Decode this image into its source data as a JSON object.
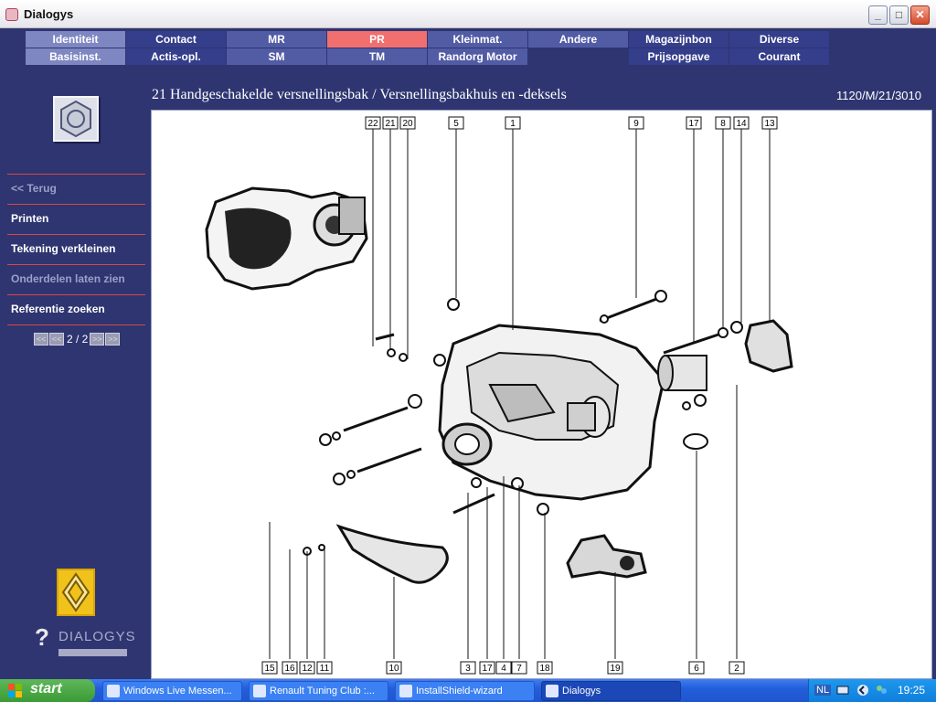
{
  "window": {
    "title": "Dialogys"
  },
  "menu": {
    "row1": [
      "Identiteit",
      "Contact",
      "MR",
      "PR",
      "Kleinmat.",
      "Andere",
      "Magazijnbon",
      "Diverse"
    ],
    "row2": [
      "Basisinst.",
      "Actis-opl.",
      "SM",
      "TM",
      "Randorg Motor",
      "",
      "Prijsopgave",
      "Courant"
    ],
    "active": "PR"
  },
  "page": {
    "title": "21 Handgeschakelde versnellingsbak / Versnellingsbakhuis en -deksels",
    "code": "1120/M/21/3010"
  },
  "sidebar": {
    "items": [
      {
        "label": "<< Terug",
        "enabled": false
      },
      {
        "label": "Printen",
        "enabled": true
      },
      {
        "label": "Tekening verkleinen",
        "enabled": true
      },
      {
        "label": "Onderdelen laten zien",
        "enabled": false
      },
      {
        "label": "Referentie zoeken",
        "enabled": true
      }
    ],
    "pager": {
      "text": "2 / 2"
    },
    "brand": "DIALOGYS"
  },
  "drawing": {
    "callouts_top": [
      "22",
      "21",
      "20",
      "5",
      "1",
      "9",
      "17",
      "8",
      "14",
      "13"
    ],
    "callouts_bottom": [
      "15",
      "16",
      "12",
      "11",
      "10",
      "3",
      "17",
      "4",
      "7",
      "18",
      "19",
      "6",
      "2"
    ]
  },
  "taskbar": {
    "start": "start",
    "tasks": [
      {
        "label": "Windows Live Messen...",
        "active": false
      },
      {
        "label": "Renault Tuning Club :...",
        "active": false
      },
      {
        "label": "InstallShield-wizard",
        "active": false
      },
      {
        "label": "Dialogys",
        "active": true
      }
    ],
    "lang": "NL",
    "clock": "19:25"
  }
}
